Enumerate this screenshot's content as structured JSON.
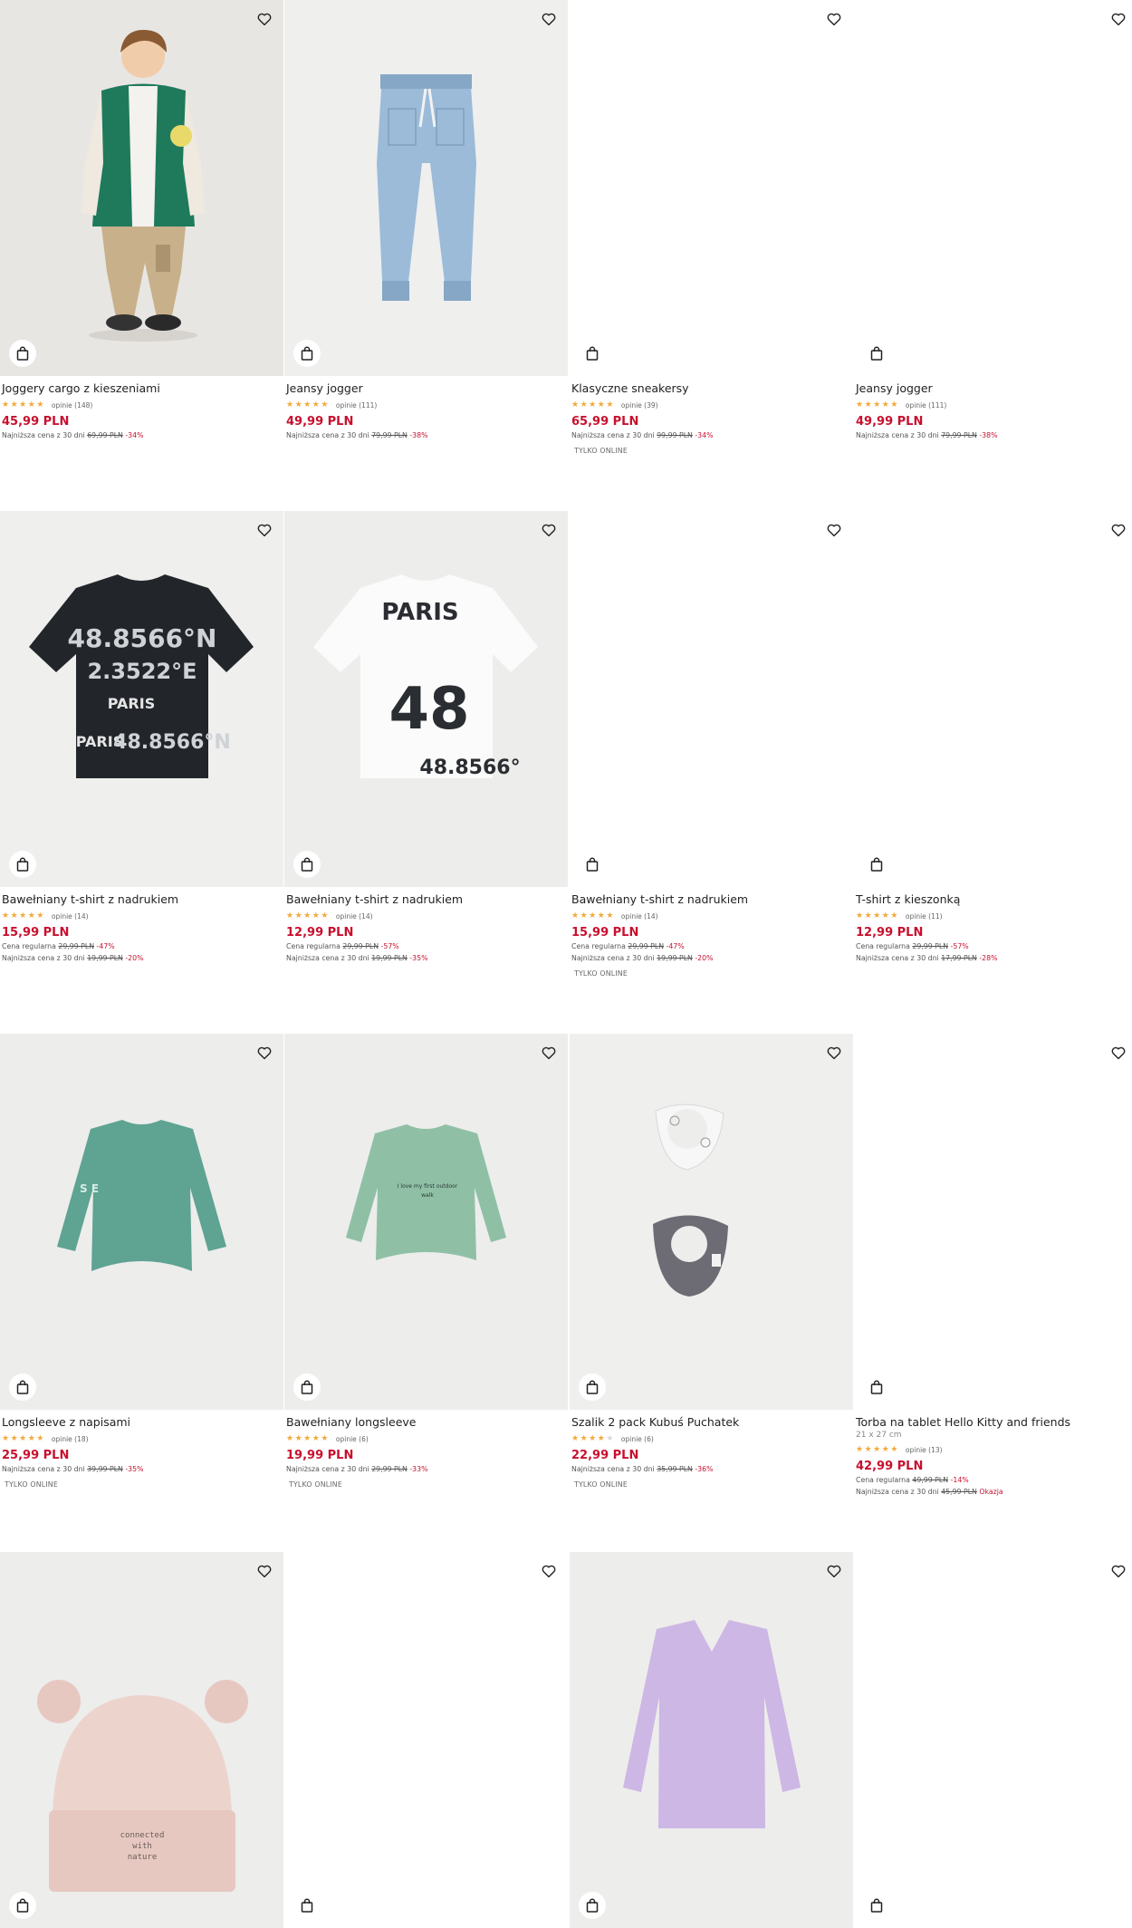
{
  "products": [
    {
      "name": "Joggery cargo z kieszeniami",
      "rating": 5,
      "reviews": "opinie (148)",
      "price": "45,99 PLN",
      "lines": [
        {
          "label": "Najniższa cena z 30 dni",
          "old": "69,99 PLN",
          "disc": "-34%"
        }
      ],
      "online": "",
      "image": "boy-cargo"
    },
    {
      "name": "Jeansy jogger",
      "rating": 5,
      "reviews": "opinie (111)",
      "price": "49,99 PLN",
      "lines": [
        {
          "label": "Najniższa cena z 30 dni",
          "old": "79,99 PLN",
          "disc": "-38%"
        }
      ],
      "online": "",
      "image": "jeans"
    },
    {
      "name": "Klasyczne sneakersy",
      "rating": 4.5,
      "reviews": "opinie (39)",
      "price": "65,99 PLN",
      "lines": [
        {
          "label": "Najniższa cena z 30 dni",
          "old": "99,99 PLN",
          "disc": "-34%"
        }
      ],
      "online": "TYLKO ONLINE",
      "image": "blank"
    },
    {
      "name": "Jeansy jogger",
      "rating": 5,
      "reviews": "opinie (111)",
      "price": "49,99 PLN",
      "lines": [
        {
          "label": "Najniższa cena z 30 dni",
          "old": "79,99 PLN",
          "disc": "-38%"
        }
      ],
      "online": "",
      "image": "blank"
    },
    {
      "name": "Bawełniany t-shirt z nadrukiem",
      "rating": 5,
      "reviews": "opinie (14)",
      "price": "15,99 PLN",
      "lines": [
        {
          "label": "Cena regularna",
          "old": "29,99 PLN",
          "disc": "-47%"
        },
        {
          "label": "Najniższa cena z 30 dni",
          "old": "19,99 PLN",
          "disc": "-20%"
        }
      ],
      "online": "",
      "image": "tshirt-black"
    },
    {
      "name": "Bawełniany t-shirt z nadrukiem",
      "rating": 5,
      "reviews": "opinie (14)",
      "price": "12,99 PLN",
      "lines": [
        {
          "label": "Cena regularna",
          "old": "29,99 PLN",
          "disc": "-57%"
        },
        {
          "label": "Najniższa cena z 30 dni",
          "old": "19,99 PLN",
          "disc": "-35%"
        }
      ],
      "online": "",
      "image": "tshirt-white"
    },
    {
      "name": "Bawełniany t-shirt z nadrukiem",
      "rating": 5,
      "reviews": "opinie (14)",
      "price": "15,99 PLN",
      "lines": [
        {
          "label": "Cena regularna",
          "old": "29,99 PLN",
          "disc": "-47%"
        },
        {
          "label": "Najniższa cena z 30 dni",
          "old": "19,99 PLN",
          "disc": "-20%"
        }
      ],
      "online": "TYLKO ONLINE",
      "image": "blank"
    },
    {
      "name": "T-shirt z kieszonką",
      "rating": 5,
      "reviews": "opinie (11)",
      "price": "12,99 PLN",
      "lines": [
        {
          "label": "Cena regularna",
          "old": "29,99 PLN",
          "disc": "-57%"
        },
        {
          "label": "Najniższa cena z 30 dni",
          "old": "17,99 PLN",
          "disc": "-28%"
        }
      ],
      "online": "",
      "image": "blank"
    },
    {
      "name": "Longsleeve z napisami",
      "rating": 4.5,
      "reviews": "opinie (18)",
      "price": "25,99 PLN",
      "lines": [
        {
          "label": "Najniższa cena z 30 dni",
          "old": "39,99 PLN",
          "disc": "-35%"
        }
      ],
      "online": "TYLKO ONLINE",
      "image": "longsleeve-1"
    },
    {
      "name": "Bawełniany longsleeve",
      "rating": 5,
      "reviews": "opinie (6)",
      "price": "19,99 PLN",
      "lines": [
        {
          "label": "Najniższa cena z 30 dni",
          "old": "29,99 PLN",
          "disc": "-33%"
        }
      ],
      "online": "TYLKO ONLINE",
      "image": "longsleeve-2"
    },
    {
      "name": "Szalik 2 pack Kubuś Puchatek",
      "rating": 4,
      "reviews": "opinie (6)",
      "price": "22,99 PLN",
      "lines": [
        {
          "label": "Najniższa cena z 30 dni",
          "old": "35,99 PLN",
          "disc": "-36%"
        }
      ],
      "online": "TYLKO ONLINE",
      "image": "bibs"
    },
    {
      "name": "Torba na tablet Hello Kitty and friends",
      "sub": "21 x 27 cm",
      "rating": 5,
      "reviews": "opinie (13)",
      "price": "42,99 PLN",
      "lines": [
        {
          "label": "Cena regularna",
          "old": "49,99 PLN",
          "disc": "-14%"
        },
        {
          "label": "Najniższa cena z 30 dni",
          "old": "45,99 PLN",
          "disc": "Okazja"
        }
      ],
      "online": "",
      "image": "blank"
    },
    {
      "image": "beanie"
    },
    {
      "image": "blank"
    },
    {
      "image": "sweater"
    },
    {
      "image": "blank"
    }
  ],
  "icons": {
    "favorite": "heart-icon",
    "cart": "shopping-bag-icon",
    "rating": "star-icon"
  },
  "colors": {
    "price": "#c8102e",
    "star": "#f2a93b",
    "star_empty": "#d8d8d8",
    "image_bg": "#f4f4f4"
  }
}
